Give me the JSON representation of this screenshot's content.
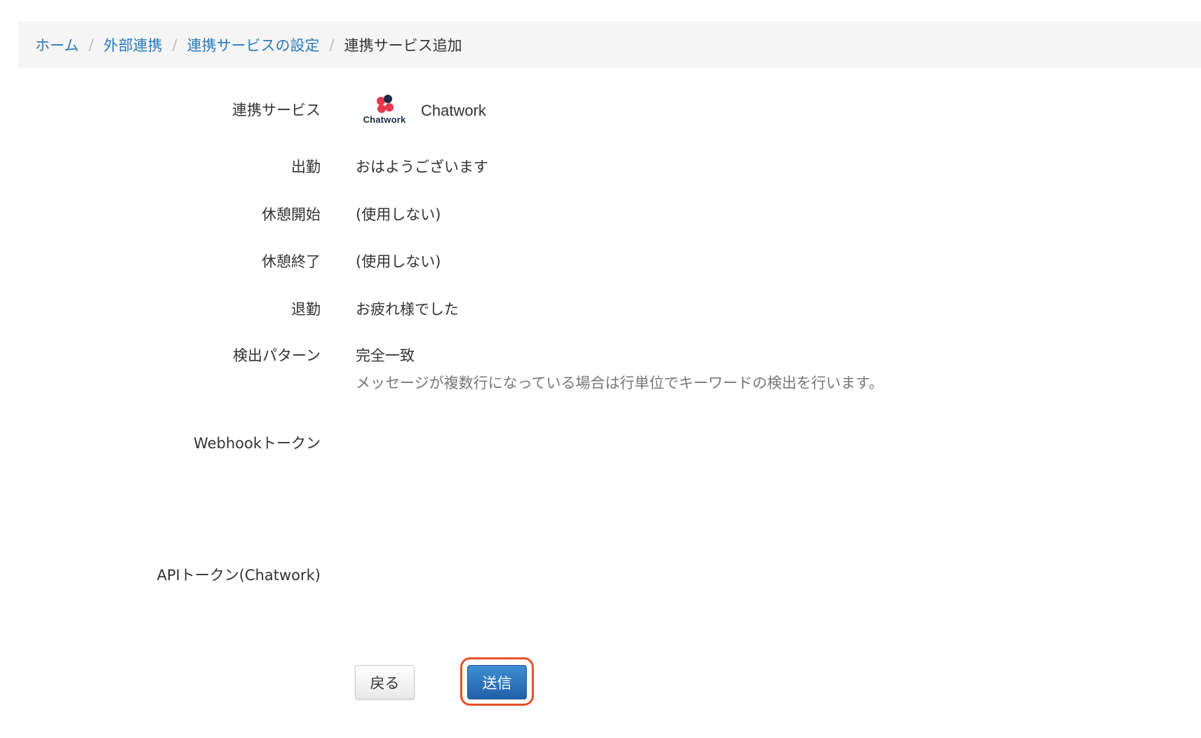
{
  "breadcrumb": {
    "items": [
      "ホーム",
      "外部連携",
      "連携サービスの設定"
    ],
    "separator": "/",
    "current": "連携サービス追加"
  },
  "form": {
    "service_label": "連携サービス",
    "service_logo_text": "Chatwork",
    "service_name": "Chatwork",
    "clock_in_label": "出勤",
    "clock_in_value": "おはようございます",
    "break_start_label": "休憩開始",
    "break_start_value": "(使用しない)",
    "break_end_label": "休憩終了",
    "break_end_value": "(使用しない)",
    "clock_out_label": "退勤",
    "clock_out_value": "お疲れ様でした",
    "pattern_label": "検出パターン",
    "pattern_value": "完全一致",
    "pattern_help": "メッセージが複数行になっている場合は行単位でキーワードの検出を行います。",
    "webhook_label": "Webhookトークン",
    "api_label": "APIトークン(Chatwork)"
  },
  "buttons": {
    "back": "戻る",
    "submit": "送信"
  },
  "colors": {
    "link": "#2a7ab9",
    "primary_button": "#2a6fb8",
    "highlight": "#e8502a",
    "logo_red": "#e8384f",
    "logo_navy": "#1d2a44"
  },
  "icons": {
    "service_logo": "chatwork-logo-icon"
  }
}
